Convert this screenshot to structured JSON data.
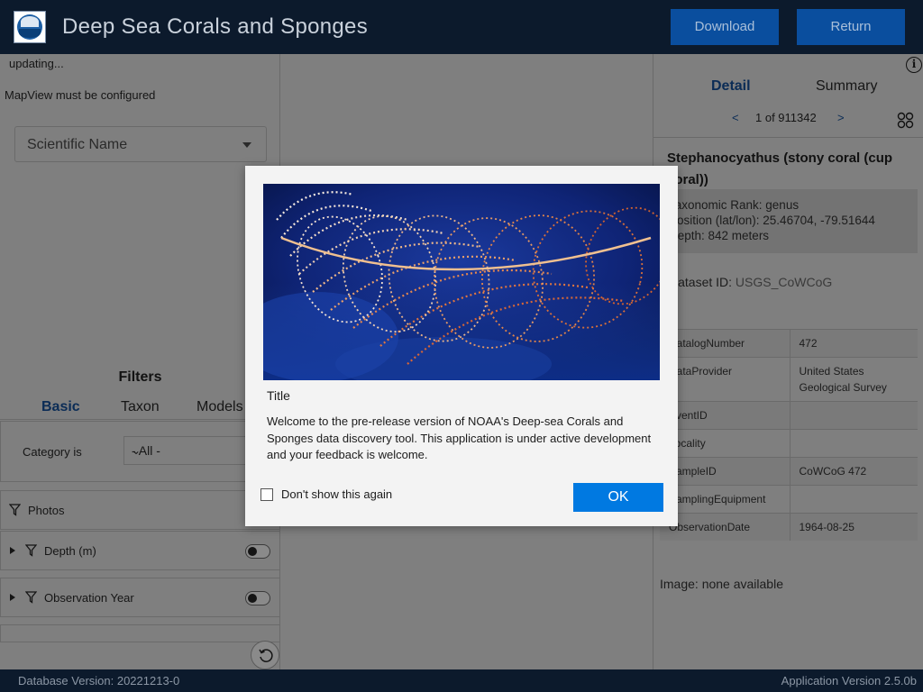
{
  "header": {
    "title": "Deep Sea Corals and Sponges",
    "download_label": "Download",
    "return_label": "Return"
  },
  "left_panel": {
    "status": "updating...",
    "map_message": "MapView must be configured",
    "scientific_name_placeholder": "Scientific Name",
    "filters_title": "Filters",
    "tabs": [
      "Basic",
      "Taxon",
      "Models"
    ],
    "active_tab": "Basic",
    "category_label": "Category is",
    "category_value": "- All -",
    "filter_rows": [
      {
        "label": "Photos",
        "expandable": false,
        "toggle": false
      },
      {
        "label": "Depth (m)",
        "expandable": true,
        "toggle": false
      },
      {
        "label": "Observation Year",
        "expandable": true,
        "toggle": false
      }
    ]
  },
  "right_panel": {
    "tabs": [
      "Detail",
      "Summary"
    ],
    "active_tab": "Detail",
    "pager": {
      "prev": "<",
      "text": "1 of 911342",
      "next": ">"
    },
    "species": "Stephanocyathus (stony coral (cup coral))",
    "taxonomic_rank": "Taxonomic Rank: genus",
    "position": "Position (lat/lon): 25.46704,  -79.51644",
    "depth": "Depth: 842 meters",
    "dataset_label": "Dataset ID:",
    "dataset_value": "USGS_CoWCoG",
    "attributes": [
      {
        "key": "CatalogNumber",
        "value": "472"
      },
      {
        "key": "DataProvider",
        "value": "United States Geological Survey"
      },
      {
        "key": "EventID",
        "value": ""
      },
      {
        "key": "Locality",
        "value": ""
      },
      {
        "key": "SampleID",
        "value": "CoWCoG 472"
      },
      {
        "key": "SamplingEquipment",
        "value": ""
      },
      {
        "key": "ObservationDate",
        "value": "1964-08-25"
      }
    ],
    "image_note": "Image: none available"
  },
  "footer": {
    "database_version": "Database Version: 20221213-0",
    "app_version": "Application Version 2.5.0b"
  },
  "modal": {
    "title": "Title",
    "body": "Welcome to the pre-release version of NOAA's Deep-sea Corals and Sponges data discovery tool. This application is under active development and your feedback is welcome.",
    "checkbox_label": "Don't show this again",
    "checkbox_checked": false,
    "ok_label": "OK"
  },
  "colors": {
    "header_bg": "#0c1a2c",
    "button_bg": "#0a4e9e",
    "ok_button": "#0079e1",
    "overlay_gray": "#7f7f7f"
  }
}
